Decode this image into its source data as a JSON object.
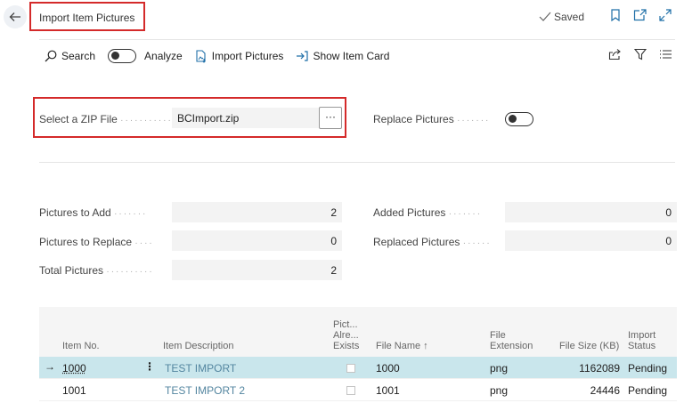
{
  "page": {
    "title": "Import Item Pictures",
    "saved_label": "Saved"
  },
  "actions": {
    "search": "Search",
    "analyze": "Analyze",
    "import_pictures": "Import Pictures",
    "show_item_card": "Show Item Card",
    "analyze_on": false
  },
  "fields": {
    "zip_label": "Select a ZIP File",
    "zip_value": "BCImport.zip",
    "zip_button": "···",
    "replace_label": "Replace Pictures",
    "replace_on": false,
    "pictures_to_add_label": "Pictures to Add",
    "pictures_to_add": "2",
    "pictures_to_replace_label": "Pictures to Replace",
    "pictures_to_replace": "0",
    "total_pictures_label": "Total Pictures",
    "total_pictures": "2",
    "added_pictures_label": "Added Pictures",
    "added_pictures": "0",
    "replaced_pictures_label": "Replaced Pictures",
    "replaced_pictures": "0"
  },
  "table": {
    "columns": {
      "item_no": "Item No.",
      "item_desc": "Item Description",
      "pict_exists_1": "Pict...",
      "pict_exists_2": "Alre...",
      "pict_exists_3": "Exists",
      "file_name": "File Name ↑",
      "file_ext_1": "File",
      "file_ext_2": "Extension",
      "file_size": "File Size (KB)",
      "import_status_1": "Import",
      "import_status_2": "Status"
    },
    "rows": [
      {
        "item_no": "1000",
        "desc": "TEST IMPORT",
        "exists": false,
        "file_name": "1000",
        "ext": "png",
        "size": "1162089",
        "status": "Pending"
      },
      {
        "item_no": "1001",
        "desc": "TEST IMPORT 2",
        "exists": false,
        "file_name": "1001",
        "ext": "png",
        "size": "24446",
        "status": "Pending"
      }
    ],
    "selected_row_arrow": "→",
    "row_menu": "⋮"
  }
}
